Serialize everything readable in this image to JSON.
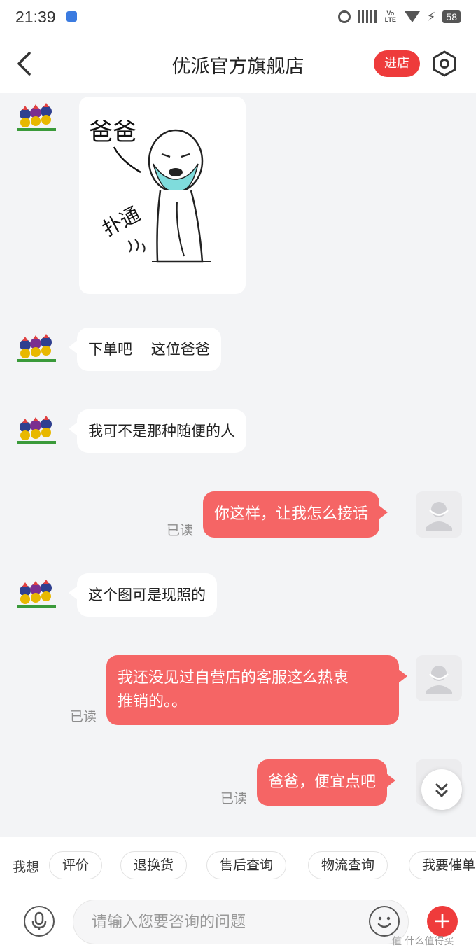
{
  "status_bar": {
    "time": "21:39",
    "network": "Vo LTE",
    "battery": "58",
    "icons": [
      "cloud-icon",
      "alarm-icon",
      "signal-icon",
      "volte-icon",
      "wifi-icon",
      "charging-icon",
      "battery-icon"
    ]
  },
  "header": {
    "title": "优派官方旗舰店",
    "enter_store": "进店",
    "back_icon": "chevron-left-icon",
    "settings_icon": "hexagon-settings-icon"
  },
  "sticker": {
    "text_top": "爸爸",
    "text_action": "扑通"
  },
  "messages": [
    {
      "from": "shop",
      "type": "sticker"
    },
    {
      "from": "shop",
      "text": "下单吧    这位爸爸"
    },
    {
      "from": "shop",
      "text": "我可不是那种随便的人"
    },
    {
      "from": "me",
      "text": "你这样，让我怎么接话",
      "status": "已读"
    },
    {
      "from": "shop",
      "text": "这个图可是现照的"
    },
    {
      "from": "me",
      "line1": "我还没见过自营店的客服这么热衷",
      "line2": "推销的。。",
      "status": "已读"
    },
    {
      "from": "me",
      "text": "爸爸，便宜点吧",
      "status": "已读"
    }
  ],
  "quick_actions": {
    "label": "我想",
    "items": [
      "评价",
      "退换货",
      "售后查询",
      "物流查询",
      "我要催单"
    ]
  },
  "input": {
    "placeholder": "请输入您要咨询的问题",
    "plus": "+"
  },
  "watermark": "值 什么值得买",
  "colors": {
    "accent_red": "#f56565",
    "store_button": "#ee3b3b",
    "background": "#f3f4f6"
  }
}
